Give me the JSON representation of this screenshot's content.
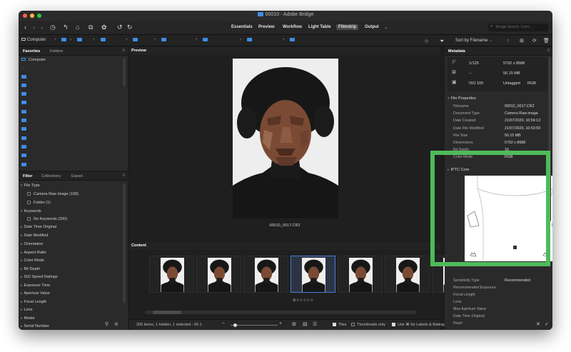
{
  "window": {
    "title": "00010 - Adobe Bridge"
  },
  "toolbar": {
    "workspaces": [
      "Essentials",
      "Preview",
      "Workflow",
      "Light Table",
      "Filmstrip",
      "Output"
    ],
    "active_workspace": "Filmstrip",
    "search_placeholder": "Bridge Search: Curre..."
  },
  "pathbar": {
    "crumbs": [
      "Computer"
    ],
    "sort_label": "Sort by Filename"
  },
  "favorites": {
    "tabs": [
      "Favorites",
      "Folders"
    ],
    "items": [
      "Computer"
    ]
  },
  "filter": {
    "tabs": [
      "Filter",
      "Collections",
      "Export"
    ],
    "groups": [
      {
        "label": "File Type",
        "expanded": true,
        "options": [
          "Camera Raw image (199)",
          "Folder (1)"
        ]
      },
      {
        "label": "Keywords",
        "expanded": true,
        "options": [
          "No Keywords (200)"
        ]
      },
      {
        "label": "Date Time Original"
      },
      {
        "label": "Date Modified"
      },
      {
        "label": "Orientation"
      },
      {
        "label": "Aspect Ratio"
      },
      {
        "label": "Color Mode"
      },
      {
        "label": "Bit Depth"
      },
      {
        "label": "ISO Speed Ratings"
      },
      {
        "label": "Exposure Time"
      },
      {
        "label": "Aperture Value"
      },
      {
        "label": "Focal Length"
      },
      {
        "label": "Lens"
      },
      {
        "label": "Model"
      },
      {
        "label": "Serial Number"
      }
    ]
  },
  "preview": {
    "tab": "Preview",
    "filename": "00010_0017.CR2"
  },
  "content": {
    "tab": "Content",
    "selected_index": 3,
    "thumb_count": 7
  },
  "statusbar": {
    "summary": "200 items, 1 hidden, 1 selected - 56.1",
    "tiles_label": "Tiles",
    "thumbs_only_label": "Thumbnails only",
    "labels_ratings_label": "Use ⌘ for Labels & Ratings"
  },
  "metadata": {
    "tab": "Metadata",
    "summary": {
      "aperture": "f/-",
      "shutter": "1/125",
      "dimensions": "5792 x 8688",
      "size": "56.15 MB",
      "flash_placeholder": "--",
      "iso": "ISO 100",
      "untagged": "Untagged",
      "color": "RGB"
    },
    "file_properties_label": "File Properties",
    "file_properties": [
      {
        "label": "Filename",
        "value": "00010_0017.CR2"
      },
      {
        "label": "Document Type",
        "value": "Camera Raw image"
      },
      {
        "label": "Date Created",
        "value": "21/07/2020, 10:54:13"
      },
      {
        "label": "Date File Modified",
        "value": "21/07/2020, 10:53:59"
      },
      {
        "label": "File Size",
        "value": "56.15 MB"
      },
      {
        "label": "Dimensions",
        "value": "5792 x 8688"
      },
      {
        "label": "Bit Depth",
        "value": "16"
      },
      {
        "label": "Color Mode",
        "value": "RGB"
      }
    ],
    "iptc_label": "IPTC Core",
    "camera_data_label": "Camera Data (Exif)",
    "camera_data": [
      {
        "label": "Sensitivity Type",
        "value": "Recommended"
      },
      {
        "label": "Recommended Exposure",
        "value": ""
      },
      {
        "label": "Focal Length",
        "value": ""
      },
      {
        "label": "Lens",
        "value": ""
      },
      {
        "label": "Max Aperture Value",
        "value": ""
      },
      {
        "label": "Date Time Original",
        "value": ""
      },
      {
        "label": "Flash",
        "value": ""
      }
    ]
  },
  "colors": {
    "accent": "#3d8ee9",
    "selection": "#4a7dd6",
    "highlight": "#4fbb5a",
    "window_bg": "#1d1d1d"
  }
}
